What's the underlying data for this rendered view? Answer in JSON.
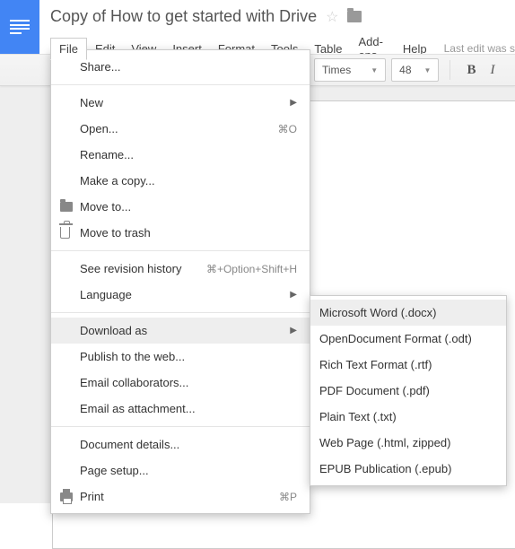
{
  "doc_title": "Copy of How to get started with Drive",
  "menubar": {
    "file": "File",
    "edit": "Edit",
    "view": "View",
    "insert": "Insert",
    "format": "Format",
    "tools": "Tools",
    "table": "Table",
    "addons": "Add-ons",
    "help": "Help",
    "last_edit": "Last edit was s"
  },
  "toolbar": {
    "font": "Times",
    "size": "48",
    "bold": "B",
    "italic": "I"
  },
  "file_menu": {
    "share": "Share...",
    "new": "New",
    "open": "Open...",
    "open_hint": "⌘O",
    "rename": "Rename...",
    "make_copy": "Make a copy...",
    "move_to": "Move to...",
    "move_trash": "Move to trash",
    "revision": "See revision history",
    "revision_hint": "⌘+Option+Shift+H",
    "language": "Language",
    "download_as": "Download as",
    "publish": "Publish to the web...",
    "email_collab": "Email collaborators...",
    "email_attach": "Email as attachment...",
    "doc_details": "Document details...",
    "page_setup": "Page setup...",
    "print": "Print",
    "print_hint": "⌘P"
  },
  "download_submenu": {
    "docx": "Microsoft Word (.docx)",
    "odt": "OpenDocument Format (.odt)",
    "rtf": "Rich Text Format (.rtf)",
    "pdf": "PDF Document (.pdf)",
    "txt": "Plain Text (.txt)",
    "html": "Web Page (.html, zipped)",
    "epub": "EPUB Publication (.epub)"
  }
}
